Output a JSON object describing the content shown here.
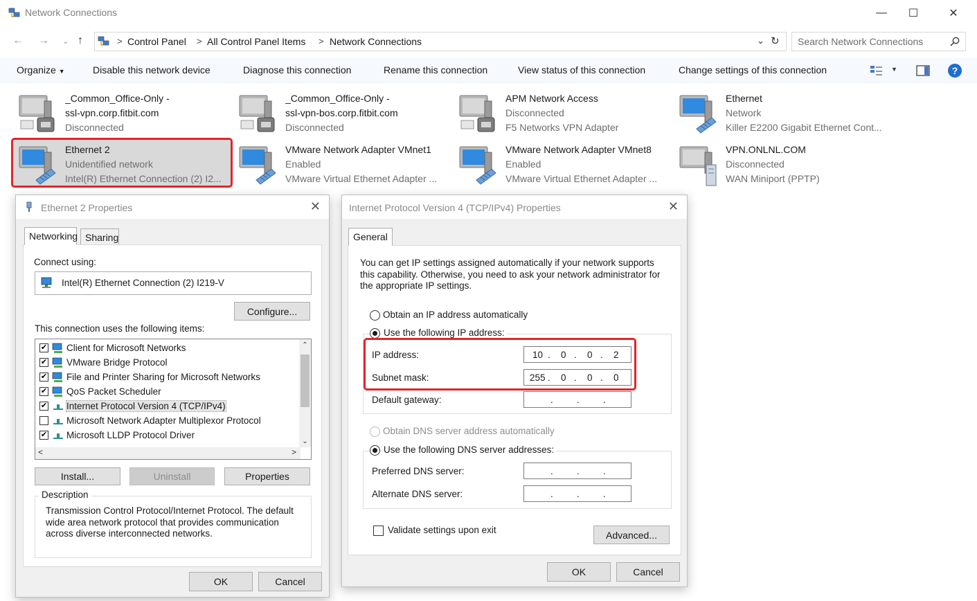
{
  "window": {
    "title": "Network Connections"
  },
  "address": {
    "crumbs": [
      "Control Panel",
      "All Control Panel Items",
      "Network Connections"
    ],
    "search_placeholder": "Search Network Connections"
  },
  "toolbar": {
    "organize": "Organize",
    "disable": "Disable this network device",
    "diagnose": "Diagnose this connection",
    "rename": "Rename this connection",
    "view_status": "View status of this connection",
    "change_settings": "Change settings of this connection"
  },
  "adapters": [
    {
      "name": "_Common_Office-Only -",
      "line2": "ssl-vpn.corp.fitbit.com",
      "line3": "Disconnected"
    },
    {
      "name": "_Common_Office-Only -",
      "line2": "ssl-vpn-bos.corp.fitbit.com",
      "line3": "Disconnected"
    },
    {
      "name": "APM Network Access",
      "line2": "Disconnected",
      "line3": "F5 Networks VPN Adapter"
    },
    {
      "name": "Ethernet",
      "line2": "Network",
      "line3": "Killer E2200 Gigabit Ethernet Cont..."
    },
    {
      "name": "Ethernet 2",
      "line2": "Unidentified network",
      "line3": "Intel(R) Ethernet Connection (2) I2..."
    },
    {
      "name": "VMware Network Adapter VMnet1",
      "line2": "Enabled",
      "line3": "VMware Virtual Ethernet Adapter ..."
    },
    {
      "name": "VMware Network Adapter VMnet8",
      "line2": "Enabled",
      "line3": "VMware Virtual Ethernet Adapter ..."
    },
    {
      "name": "VPN.ONLNL.COM",
      "line2": "Disconnected",
      "line3": "WAN Miniport (PPTP)"
    }
  ],
  "eth_props": {
    "title": "Ethernet 2 Properties",
    "tabs": [
      "Networking",
      "Sharing"
    ],
    "connect_using": "Connect using:",
    "adapter": "Intel(R) Ethernet Connection (2) I219-V",
    "configure": "Configure...",
    "items_label": "This connection uses the following items:",
    "items": [
      {
        "checked": true,
        "label": "Client for Microsoft Networks"
      },
      {
        "checked": true,
        "label": "VMware Bridge Protocol"
      },
      {
        "checked": true,
        "label": "File and Printer Sharing for Microsoft Networks"
      },
      {
        "checked": true,
        "label": "QoS Packet Scheduler"
      },
      {
        "checked": true,
        "label": "Internet Protocol Version 4 (TCP/IPv4)"
      },
      {
        "checked": false,
        "label": "Microsoft Network Adapter Multiplexor Protocol"
      },
      {
        "checked": true,
        "label": "Microsoft LLDP Protocol Driver"
      }
    ],
    "install": "Install...",
    "uninstall": "Uninstall",
    "properties": "Properties",
    "description_label": "Description",
    "description": "Transmission Control Protocol/Internet Protocol. The default wide area network protocol that provides communication across diverse interconnected networks.",
    "ok": "OK",
    "cancel": "Cancel"
  },
  "ipv4": {
    "title": "Internet Protocol Version 4 (TCP/IPv4) Properties",
    "tab": "General",
    "intro": "You can get IP settings assigned automatically if your network supports this capability. Otherwise, you need to ask your network administrator for the appropriate IP settings.",
    "obtain_ip": "Obtain an IP address automatically",
    "use_ip": "Use the following IP address:",
    "ip_label": "IP address:",
    "ip": [
      "10",
      "0",
      "0",
      "2"
    ],
    "subnet_label": "Subnet mask:",
    "subnet": [
      "255",
      "0",
      "0",
      "0"
    ],
    "gateway_label": "Default gateway:",
    "obtain_dns": "Obtain DNS server address automatically",
    "use_dns": "Use the following DNS server addresses:",
    "pref_dns_label": "Preferred DNS server:",
    "alt_dns_label": "Alternate DNS server:",
    "validate": "Validate settings upon exit",
    "advanced": "Advanced...",
    "ok": "OK",
    "cancel": "Cancel"
  }
}
